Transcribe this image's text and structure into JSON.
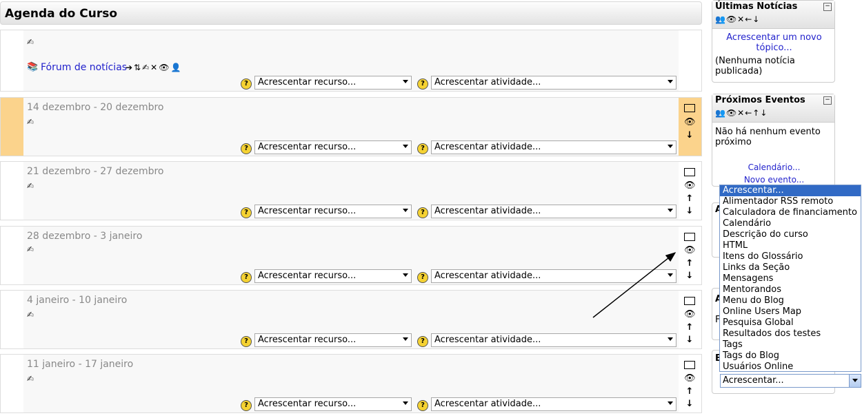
{
  "page_title": "Agenda do Curso",
  "add_resource": "Acrescentar recurso...",
  "add_activity": "Acrescentar atividade...",
  "forum_link": "Fórum de notícias",
  "sections": [
    {
      "summary": ""
    },
    {
      "summary": "14 dezembro - 20 dezembro"
    },
    {
      "summary": "21 dezembro - 27 dezembro"
    },
    {
      "summary": "28 dezembro - 3 janeiro"
    },
    {
      "summary": "4 janeiro - 10 janeiro"
    },
    {
      "summary": "11 janeiro - 17 janeiro"
    }
  ],
  "news_block": {
    "title": "Últimas Notícias",
    "add_link": "Acrescentar um novo tópico...",
    "empty": "(Nenhuma notícia publicada)"
  },
  "events_block": {
    "title": "Próximos Eventos",
    "empty": "Não há nenhum evento próximo",
    "calendar_link": "Calendário...",
    "new_event_link": "Novo evento..."
  },
  "hidden_fragments": {
    "a1": "A",
    "a2": "A",
    "f": "F",
    "b": "B"
  },
  "add_block": {
    "selected": "Acrescentar...",
    "options": [
      "Acrescentar...",
      "Alimentador RSS remoto",
      "Calculadora de financiamento",
      "Calendário",
      "Descrição do curso",
      "HTML",
      "Itens do Glossário",
      "Links da Seção",
      "Mensagens",
      "Mentorandos",
      "Menu do Blog",
      "Online Users Map",
      "Pesquisa Global",
      "Resultados dos testes",
      "Tags",
      "Tags do Blog",
      "Usuários Online"
    ]
  },
  "colors": {
    "current_section": "#fbd38c",
    "link": "#2222cc",
    "highlight": "#316ac5"
  }
}
